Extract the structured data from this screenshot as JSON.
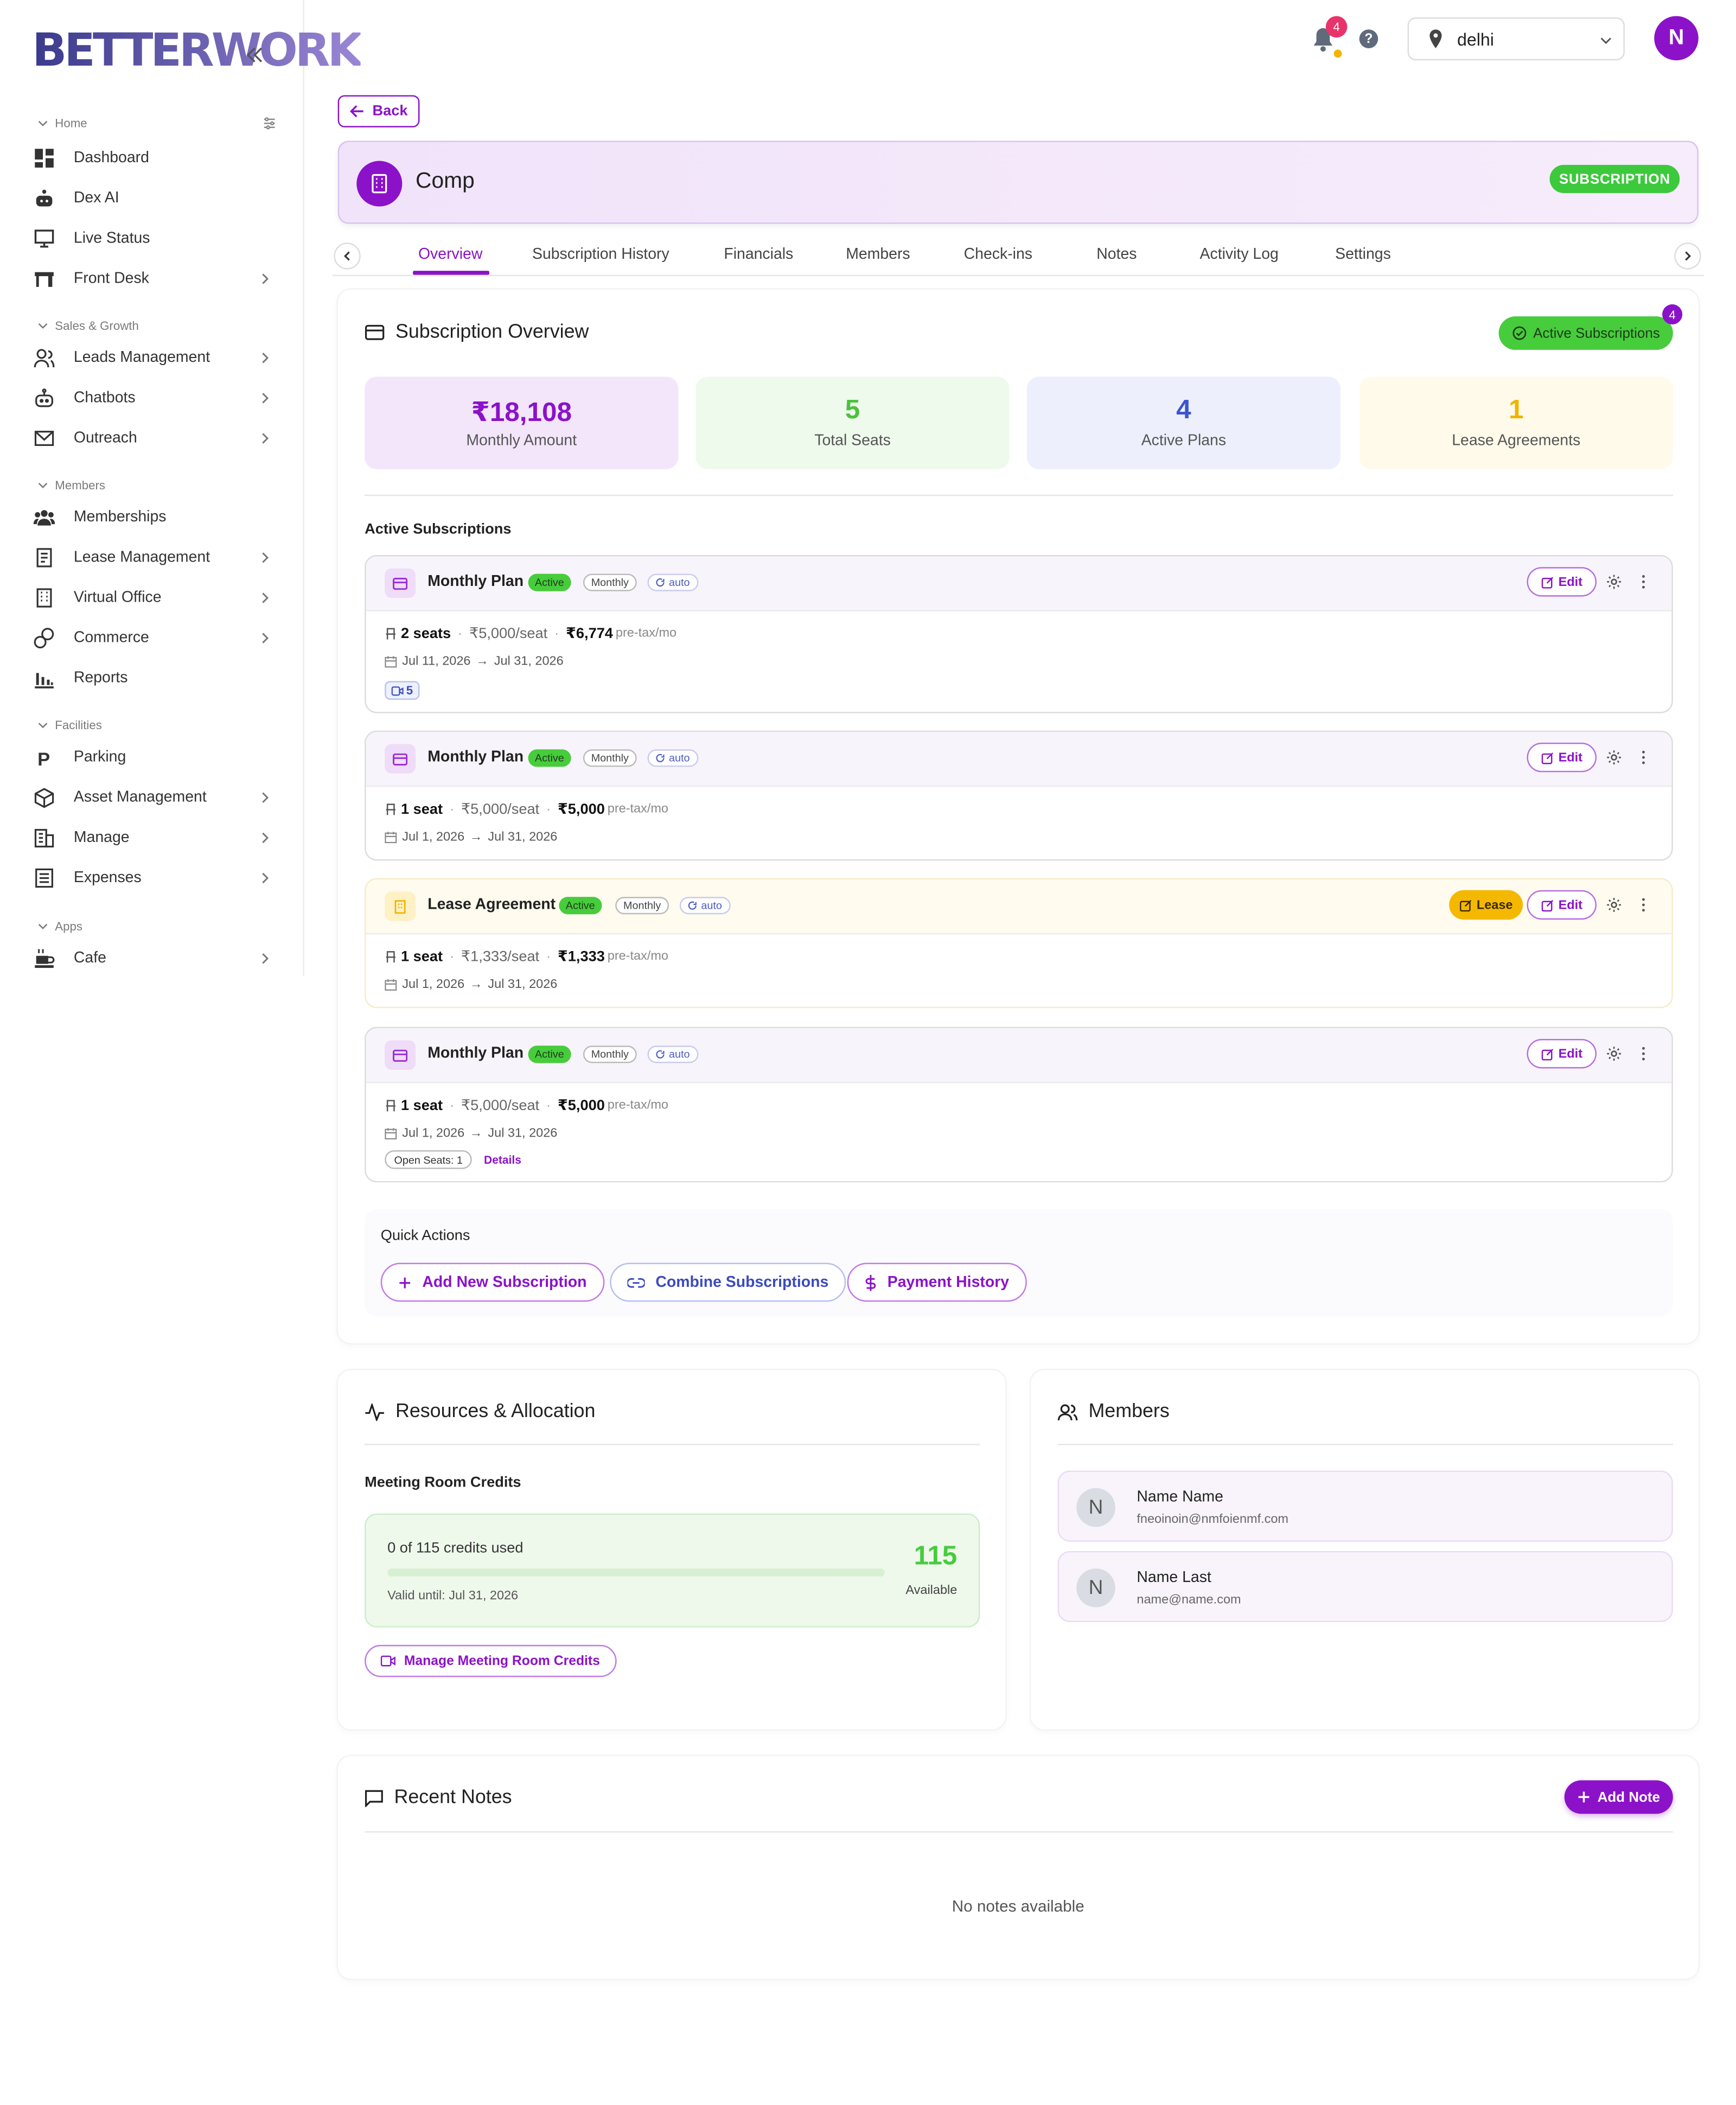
{
  "brand": {
    "logo_text": "BETTERWORK"
  },
  "sidebar": {
    "sections": [
      {
        "label": "Home"
      },
      {
        "label": "Sales & Growth"
      },
      {
        "label": "Members"
      },
      {
        "label": "Facilities"
      },
      {
        "label": "Apps"
      }
    ],
    "items": [
      {
        "label": "Dashboard",
        "icon": "dashboard-icon"
      },
      {
        "label": "Dex AI",
        "icon": "robot-icon"
      },
      {
        "label": "Live Status",
        "icon": "monitor-icon"
      },
      {
        "label": "Front Desk",
        "icon": "desk-icon"
      },
      {
        "label": "Leads Management",
        "icon": "users-icon"
      },
      {
        "label": "Chatbots",
        "icon": "bot-icon"
      },
      {
        "label": "Outreach",
        "icon": "mail-icon"
      },
      {
        "label": "Memberships",
        "icon": "group-icon"
      },
      {
        "label": "Lease Management",
        "icon": "document-icon"
      },
      {
        "label": "Virtual Office",
        "icon": "building-icon"
      },
      {
        "label": "Commerce",
        "icon": "coins-icon"
      },
      {
        "label": "Reports",
        "icon": "bar-chart-icon"
      },
      {
        "label": "Parking",
        "icon": "parking-icon"
      },
      {
        "label": "Asset Management",
        "icon": "box-icon"
      },
      {
        "label": "Manage",
        "icon": "office-icon"
      },
      {
        "label": "Expenses",
        "icon": "list-icon"
      },
      {
        "label": "Cafe",
        "icon": "cafe-icon"
      }
    ]
  },
  "header": {
    "notification_count": "4",
    "help": "?",
    "location": "delhi",
    "avatar_initial": "N"
  },
  "back_label": "Back",
  "company": {
    "name": "Comp",
    "badge": "SUBSCRIPTION"
  },
  "tabs": [
    "Overview",
    "Subscription History",
    "Financials",
    "Members",
    "Check-ins",
    "Notes",
    "Activity Log",
    "Settings"
  ],
  "overview": {
    "title": "Subscription Overview",
    "active_btn": "Active Subscriptions",
    "active_count": "4",
    "stats": [
      {
        "value": "₹18,108",
        "label": "Monthly Amount",
        "color": "#8b12c9",
        "bg": "#f3e6fa"
      },
      {
        "value": "5",
        "label": "Total Seats",
        "color": "#4cc23c",
        "bg": "#eefaec"
      },
      {
        "value": "4",
        "label": "Active Plans",
        "color": "#3b55cf",
        "bg": "#edf0fc"
      },
      {
        "value": "1",
        "label": "Lease Agreements",
        "color": "#f0b400",
        "bg": "#fffaea"
      }
    ],
    "list_label": "Active Subscriptions"
  },
  "subscriptions": [
    {
      "title": "Monthly Plan",
      "status": "Active",
      "cycle": "Monthly",
      "auto": "auto",
      "seats": "2 seats",
      "rate": "₹5,000/seat",
      "total": "₹6,774",
      "suffix": "pre-tax/mo",
      "start": "Jul 11, 2026",
      "end": "Jul 31, 2026",
      "chip": "5",
      "edit": "Edit"
    },
    {
      "title": "Monthly Plan",
      "status": "Active",
      "cycle": "Monthly",
      "auto": "auto",
      "seats": "1 seat",
      "rate": "₹5,000/seat",
      "total": "₹5,000",
      "suffix": "pre-tax/mo",
      "start": "Jul 1, 2026",
      "end": "Jul 31, 2026",
      "edit": "Edit"
    },
    {
      "title": "Lease Agreement",
      "status": "Active",
      "cycle": "Monthly",
      "auto": "auto",
      "seats": "1 seat",
      "rate": "₹1,333/seat",
      "total": "₹1,333",
      "suffix": "pre-tax/mo",
      "start": "Jul 1, 2026",
      "end": "Jul 31, 2026",
      "lease": "Lease",
      "edit": "Edit"
    },
    {
      "title": "Monthly Plan",
      "status": "Active",
      "cycle": "Monthly",
      "auto": "auto",
      "seats": "1 seat",
      "rate": "₹5,000/seat",
      "total": "₹5,000",
      "suffix": "pre-tax/mo",
      "start": "Jul 1, 2026",
      "end": "Jul 31, 2026",
      "open_seats": "Open Seats: 1",
      "details": "Details",
      "edit": "Edit"
    }
  ],
  "quick_actions": {
    "title": "Quick Actions",
    "buttons": [
      "Add New Subscription",
      "Combine Subscriptions",
      "Payment History"
    ]
  },
  "resources": {
    "title": "Resources & Allocation",
    "credits_label": "Meeting Room Credits",
    "used_text": "0 of 115 credits used",
    "used_fraction": 0,
    "valid_until": "Valid until: Jul 31, 2026",
    "available_value": "115",
    "available_label": "Available",
    "manage_btn": "Manage Meeting Room Credits"
  },
  "members": {
    "title": "Members",
    "list": [
      {
        "initial": "N",
        "name": "Name Name",
        "email": "fneoinoin@nmfoienmf.com"
      },
      {
        "initial": "N",
        "name": "Name Last",
        "email": "name@name.com"
      }
    ]
  },
  "notes": {
    "title": "Recent Notes",
    "add_btn": "Add Note",
    "empty": "No notes available"
  }
}
